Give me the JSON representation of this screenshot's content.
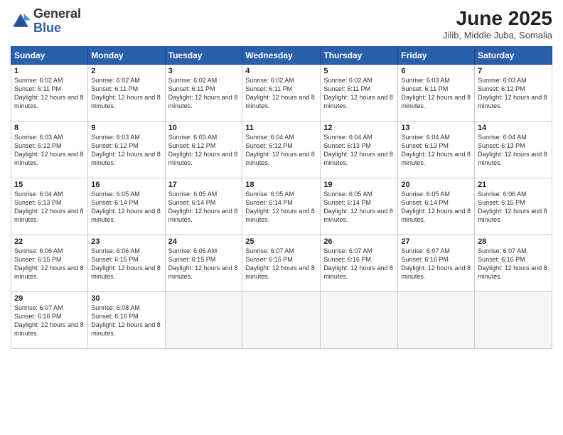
{
  "header": {
    "logo_general": "General",
    "logo_blue": "Blue",
    "month_title": "June 2025",
    "location": "Jilib, Middle Juba, Somalia"
  },
  "weekdays": [
    "Sunday",
    "Monday",
    "Tuesday",
    "Wednesday",
    "Thursday",
    "Friday",
    "Saturday"
  ],
  "weeks": [
    [
      {
        "day": "1",
        "sunrise": "6:02 AM",
        "sunset": "6:11 PM",
        "daylight": "12 hours and 8 minutes"
      },
      {
        "day": "2",
        "sunrise": "6:02 AM",
        "sunset": "6:11 PM",
        "daylight": "12 hours and 8 minutes"
      },
      {
        "day": "3",
        "sunrise": "6:02 AM",
        "sunset": "6:11 PM",
        "daylight": "12 hours and 8 minutes"
      },
      {
        "day": "4",
        "sunrise": "6:02 AM",
        "sunset": "6:11 PM",
        "daylight": "12 hours and 8 minutes"
      },
      {
        "day": "5",
        "sunrise": "6:02 AM",
        "sunset": "6:11 PM",
        "daylight": "12 hours and 8 minutes"
      },
      {
        "day": "6",
        "sunrise": "6:03 AM",
        "sunset": "6:11 PM",
        "daylight": "12 hours and 8 minutes"
      },
      {
        "day": "7",
        "sunrise": "6:03 AM",
        "sunset": "6:12 PM",
        "daylight": "12 hours and 8 minutes"
      }
    ],
    [
      {
        "day": "8",
        "sunrise": "6:03 AM",
        "sunset": "6:12 PM",
        "daylight": "12 hours and 8 minutes"
      },
      {
        "day": "9",
        "sunrise": "6:03 AM",
        "sunset": "6:12 PM",
        "daylight": "12 hours and 8 minutes"
      },
      {
        "day": "10",
        "sunrise": "6:03 AM",
        "sunset": "6:12 PM",
        "daylight": "12 hours and 8 minutes"
      },
      {
        "day": "11",
        "sunrise": "6:04 AM",
        "sunset": "6:12 PM",
        "daylight": "12 hours and 8 minutes"
      },
      {
        "day": "12",
        "sunrise": "6:04 AM",
        "sunset": "6:13 PM",
        "daylight": "12 hours and 8 minutes"
      },
      {
        "day": "13",
        "sunrise": "6:04 AM",
        "sunset": "6:13 PM",
        "daylight": "12 hours and 8 minutes"
      },
      {
        "day": "14",
        "sunrise": "6:04 AM",
        "sunset": "6:13 PM",
        "daylight": "12 hours and 8 minutes"
      }
    ],
    [
      {
        "day": "15",
        "sunrise": "6:04 AM",
        "sunset": "6:13 PM",
        "daylight": "12 hours and 8 minutes"
      },
      {
        "day": "16",
        "sunrise": "6:05 AM",
        "sunset": "6:14 PM",
        "daylight": "12 hours and 8 minutes"
      },
      {
        "day": "17",
        "sunrise": "6:05 AM",
        "sunset": "6:14 PM",
        "daylight": "12 hours and 8 minutes"
      },
      {
        "day": "18",
        "sunrise": "6:05 AM",
        "sunset": "6:14 PM",
        "daylight": "12 hours and 8 minutes"
      },
      {
        "day": "19",
        "sunrise": "6:05 AM",
        "sunset": "6:14 PM",
        "daylight": "12 hours and 8 minutes"
      },
      {
        "day": "20",
        "sunrise": "6:05 AM",
        "sunset": "6:14 PM",
        "daylight": "12 hours and 8 minutes"
      },
      {
        "day": "21",
        "sunrise": "6:06 AM",
        "sunset": "6:15 PM",
        "daylight": "12 hours and 8 minutes"
      }
    ],
    [
      {
        "day": "22",
        "sunrise": "6:06 AM",
        "sunset": "6:15 PM",
        "daylight": "12 hours and 8 minutes"
      },
      {
        "day": "23",
        "sunrise": "6:06 AM",
        "sunset": "6:15 PM",
        "daylight": "12 hours and 8 minutes"
      },
      {
        "day": "24",
        "sunrise": "6:06 AM",
        "sunset": "6:15 PM",
        "daylight": "12 hours and 8 minutes"
      },
      {
        "day": "25",
        "sunrise": "6:07 AM",
        "sunset": "6:15 PM",
        "daylight": "12 hours and 8 minutes"
      },
      {
        "day": "26",
        "sunrise": "6:07 AM",
        "sunset": "6:16 PM",
        "daylight": "12 hours and 8 minutes"
      },
      {
        "day": "27",
        "sunrise": "6:07 AM",
        "sunset": "6:16 PM",
        "daylight": "12 hours and 8 minutes"
      },
      {
        "day": "28",
        "sunrise": "6:07 AM",
        "sunset": "6:16 PM",
        "daylight": "12 hours and 8 minutes"
      }
    ],
    [
      {
        "day": "29",
        "sunrise": "6:07 AM",
        "sunset": "6:16 PM",
        "daylight": "12 hours and 8 minutes"
      },
      {
        "day": "30",
        "sunrise": "6:08 AM",
        "sunset": "6:16 PM",
        "daylight": "12 hours and 8 minutes"
      },
      null,
      null,
      null,
      null,
      null
    ]
  ]
}
